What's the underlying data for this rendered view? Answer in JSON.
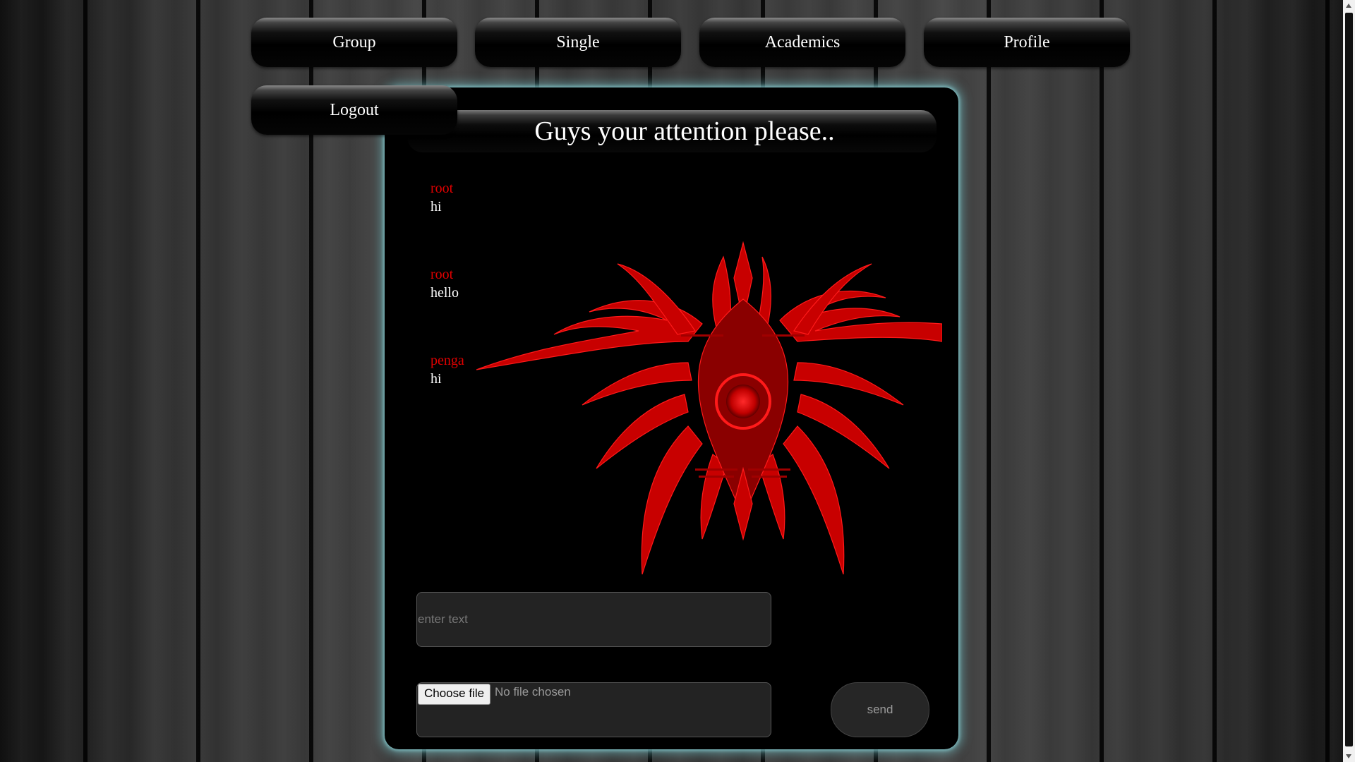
{
  "nav": {
    "group": "Group",
    "single": "Single",
    "academics": "Academics",
    "profile": "Profile",
    "logout": "Logout"
  },
  "chat": {
    "banner": "Guys your attention please..",
    "messages": [
      {
        "author": "root",
        "text": "hi"
      },
      {
        "author": "root",
        "text": "hello"
      },
      {
        "author": "penga",
        "text": "hi"
      }
    ],
    "input_placeholder": "enter text",
    "input_value": "",
    "choose_file_label": "Choose file",
    "file_status": "No file chosen",
    "send_label": "send"
  },
  "colors": {
    "author": "#e00000",
    "emblem": "#d40000",
    "panel_glow": "#78c8cd",
    "background": "#2e2e2e"
  },
  "icons": {
    "emblem": "red-tribal-emblem-icon"
  }
}
